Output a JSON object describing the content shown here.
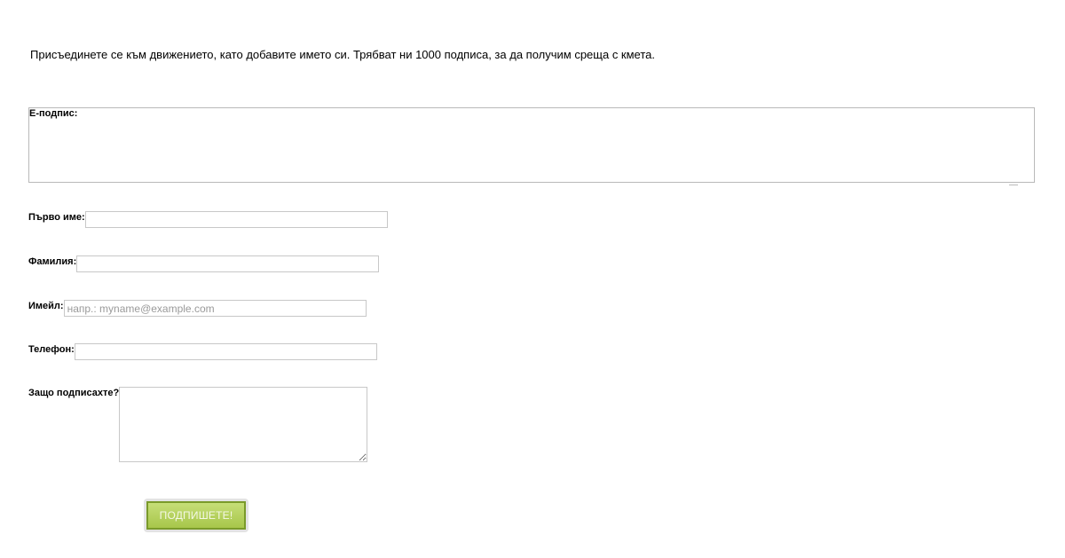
{
  "intro_text": "Присъединете се към движението, като добавите името си. Трябват ни 1000 подписа, за да получим среща с кмета.",
  "form": {
    "signature_label": "Е-подпис:",
    "first_name_label": "Първо име:",
    "first_name_value": "",
    "last_name_label": "Фамилия:",
    "last_name_value": "",
    "email_label": "Имейл:",
    "email_placeholder": "напр.: myname@example.com",
    "phone_label": "Телефон:",
    "phone_value": "",
    "why_label": "Защо подписахте?",
    "submit_label": "ПОДПИШЕТЕ!"
  },
  "colors": {
    "button_green": "#a7c64a",
    "button_border": "#7a9a2a"
  }
}
